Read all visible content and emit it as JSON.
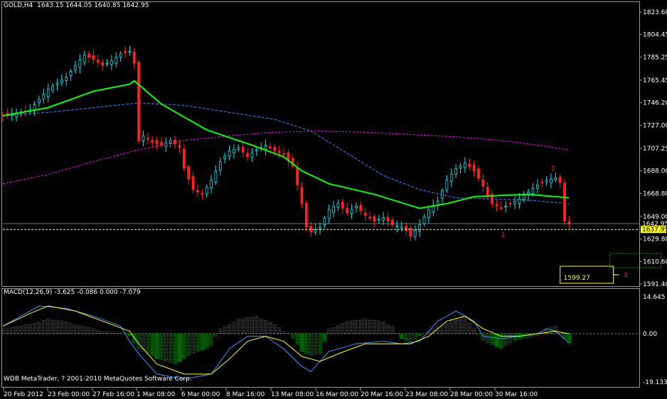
{
  "header": {
    "symbol": "GOLD,H4",
    "ohlc": "1643.15 1644.05 1640.85 1642.95"
  },
  "macd_header": {
    "label": "MACD(12,26,9)",
    "values": "-3.625 -0.086 0.000 -7.079"
  },
  "footer": "WDB MetaTrader, ? 2001-2010 MetaQuotes Software Corp.",
  "price_axis_labels": [
    "1823.60",
    "1804.45",
    "1785.25",
    "1765.45",
    "1746.20",
    "1727.00",
    "1707.25",
    "1688.00",
    "1668.80",
    "1649.00",
    "1629.80",
    "1610.60",
    "1591.40"
  ],
  "price_tags": {
    "current": "1642.95",
    "level": "1637.95"
  },
  "macd_axis_labels": [
    "14.645",
    "0.00",
    "-19.133"
  ],
  "time_labels": [
    "20 Feb 2012",
    "23 Feb 00:00",
    "27 Feb 16:00",
    "1 Mar 08:00",
    "6 Mar 00:00",
    "8 Mar 16:00",
    "13 Mar 08:00",
    "16 Mar 00:00",
    "20 Mar 16:00",
    "23 Mar 08:00",
    "28 Mar 00:00",
    "30 Mar 16:00"
  ],
  "annotations": {
    "target_box_label": "1599.27",
    "wave_1": "1",
    "wave_2": "2",
    "wave_3": "3"
  },
  "colors": {
    "background": "#000000",
    "bull_candle": "#00e5ee",
    "bear_candle": "#ff2020",
    "ma_fast": "#00ff00",
    "ma_mid": "#1e90ff",
    "ma_slow": "#ff00ff",
    "macd_pos_hist": "#ff3030",
    "macd_neg_hist": "#00b000",
    "macd_line": "#3399ff",
    "signal_line": "#ffff00",
    "level_line": "#ffff80",
    "tag_yellow": "#ffff00",
    "annotation_red": "#ff2020",
    "box_green": "#00c000"
  },
  "chart_data": [
    {
      "type": "candlestick",
      "title": "GOLD,H4",
      "ylim": [
        1591.4,
        1823.6
      ],
      "x": [
        "20 Feb 2012",
        "23 Feb 00:00",
        "27 Feb 16:00",
        "1 Mar 08:00",
        "6 Mar 00:00",
        "8 Mar 16:00",
        "13 Mar 08:00",
        "16 Mar 00:00",
        "20 Mar 16:00",
        "23 Mar 08:00",
        "28 Mar 00:00",
        "30 Mar 16:00"
      ],
      "close_path": [
        [
          0,
          1735
        ],
        [
          6,
          1740
        ],
        [
          10,
          1758
        ],
        [
          14,
          1768
        ],
        [
          16,
          1778
        ],
        [
          18,
          1787
        ],
        [
          20,
          1783
        ],
        [
          22,
          1778
        ],
        [
          24,
          1782
        ],
        [
          26,
          1788
        ],
        [
          28,
          1790
        ],
        [
          29,
          1780
        ],
        [
          29.2,
          1710
        ],
        [
          31,
          1718
        ],
        [
          33,
          1712
        ],
        [
          35,
          1710
        ],
        [
          37,
          1714
        ],
        [
          39,
          1708
        ],
        [
          40,
          1690
        ],
        [
          42,
          1672
        ],
        [
          44,
          1668
        ],
        [
          46,
          1680
        ],
        [
          48,
          1696
        ],
        [
          50,
          1705
        ],
        [
          52,
          1708
        ],
        [
          54,
          1700
        ],
        [
          56,
          1706
        ],
        [
          58,
          1710
        ],
        [
          60,
          1705
        ],
        [
          62,
          1702
        ],
        [
          64,
          1692
        ],
        [
          66,
          1660
        ],
        [
          67,
          1640
        ],
        [
          68,
          1636
        ],
        [
          70,
          1640
        ],
        [
          72,
          1655
        ],
        [
          74,
          1660
        ],
        [
          76,
          1652
        ],
        [
          78,
          1658
        ],
        [
          80,
          1650
        ],
        [
          82,
          1645
        ],
        [
          84,
          1648
        ],
        [
          86,
          1642
        ],
        [
          88,
          1640
        ],
        [
          89,
          1637
        ],
        [
          90,
          1632
        ],
        [
          92,
          1642
        ],
        [
          94,
          1655
        ],
        [
          96,
          1662
        ],
        [
          98,
          1680
        ],
        [
          100,
          1690
        ],
        [
          102,
          1695
        ],
        [
          104,
          1688
        ],
        [
          106,
          1675
        ],
        [
          108,
          1660
        ],
        [
          110,
          1656
        ],
        [
          112,
          1660
        ],
        [
          114,
          1664
        ],
        [
          116,
          1670
        ],
        [
          118,
          1676
        ],
        [
          120,
          1680
        ],
        [
          122,
          1682
        ],
        [
          123,
          1678
        ],
        [
          124,
          1645
        ],
        [
          125,
          1642.95
        ]
      ],
      "series": [
        {
          "name": "ma_fast",
          "values": [
            [
              0,
              1735
            ],
            [
              10,
              1742
            ],
            [
              20,
              1756
            ],
            [
              28,
              1762
            ],
            [
              29,
              1765
            ],
            [
              35,
              1745
            ],
            [
              45,
              1723
            ],
            [
              55,
              1710
            ],
            [
              62,
              1700
            ],
            [
              66,
              1688
            ],
            [
              72,
              1677
            ],
            [
              82,
              1668
            ],
            [
              92,
              1656
            ],
            [
              98,
              1660
            ],
            [
              104,
              1666
            ],
            [
              110,
              1667
            ],
            [
              116,
              1668
            ],
            [
              122,
              1666
            ],
            [
              125,
              1665
            ]
          ]
        },
        {
          "name": "ma_mid",
          "values": [
            [
              0,
              1735
            ],
            [
              10,
              1738
            ],
            [
              20,
              1742
            ],
            [
              30,
              1746
            ],
            [
              40,
              1744
            ],
            [
              50,
              1738
            ],
            [
              60,
              1732
            ],
            [
              68,
              1722
            ],
            [
              76,
              1703
            ],
            [
              84,
              1684
            ],
            [
              92,
              1672
            ],
            [
              100,
              1665
            ],
            [
              108,
              1664
            ],
            [
              116,
              1663
            ],
            [
              122,
              1661
            ],
            [
              125,
              1660
            ]
          ]
        },
        {
          "name": "ma_slow",
          "values": [
            [
              0,
              1677
            ],
            [
              10,
              1685
            ],
            [
              20,
              1696
            ],
            [
              30,
              1706
            ],
            [
              40,
              1714
            ],
            [
              50,
              1718
            ],
            [
              60,
              1721
            ],
            [
              70,
              1722
            ],
            [
              80,
              1721
            ],
            [
              90,
              1719
            ],
            [
              100,
              1717
            ],
            [
              110,
              1714
            ],
            [
              118,
              1710
            ],
            [
              125,
              1706
            ]
          ]
        }
      ],
      "annotations": [
        {
          "text": "1",
          "x": 110,
          "y": 1637
        },
        {
          "text": "2",
          "x": 121,
          "y": 1687
        },
        {
          "text": "3",
          "x": 137,
          "y": 1599.27
        },
        {
          "text": "1599.27",
          "x": 123,
          "y": 1599.27
        }
      ]
    },
    {
      "type": "bar",
      "title": "MACD(12,26,9)",
      "ylim": [
        -19.133,
        14.645
      ],
      "x": [
        "20 Feb 2012",
        "23 Feb 00:00",
        "27 Feb 16:00",
        "1 Mar 08:00",
        "6 Mar 00:00",
        "8 Mar 16:00",
        "13 Mar 08:00",
        "16 Mar 00:00",
        "20 Mar 16:00",
        "23 Mar 08:00",
        "28 Mar 00:00",
        "30 Mar 16:00"
      ],
      "series": [
        {
          "name": "histogram",
          "values": [
            [
              0,
              2
            ],
            [
              6,
              4
            ],
            [
              10,
              6
            ],
            [
              14,
              5
            ],
            [
              18,
              3
            ],
            [
              22,
              1
            ],
            [
              26,
              0.5
            ],
            [
              28,
              -1
            ],
            [
              30,
              -6
            ],
            [
              34,
              -10
            ],
            [
              38,
              -12
            ],
            [
              42,
              -8
            ],
            [
              46,
              -5
            ],
            [
              48,
              2
            ],
            [
              52,
              6
            ],
            [
              56,
              7
            ],
            [
              60,
              4
            ],
            [
              62,
              1
            ],
            [
              64,
              -2
            ],
            [
              66,
              -7
            ],
            [
              68,
              -9
            ],
            [
              70,
              -8
            ],
            [
              72,
              2
            ],
            [
              76,
              5
            ],
            [
              80,
              6
            ],
            [
              84,
              5
            ],
            [
              86,
              3
            ],
            [
              88,
              -2
            ],
            [
              90,
              -4
            ],
            [
              92,
              -1
            ],
            [
              96,
              3
            ],
            [
              100,
              6
            ],
            [
              102,
              7
            ],
            [
              106,
              -3
            ],
            [
              110,
              -6
            ],
            [
              114,
              -2
            ],
            [
              118,
              -1
            ],
            [
              120,
              2
            ],
            [
              122,
              3
            ],
            [
              124,
              -2
            ],
            [
              125,
              -3.625
            ]
          ]
        },
        {
          "name": "macd_line",
          "values": [
            [
              0,
              3
            ],
            [
              4,
              7
            ],
            [
              8,
              11
            ],
            [
              14,
              10
            ],
            [
              20,
              7
            ],
            [
              26,
              3
            ],
            [
              28,
              -3
            ],
            [
              30,
              -8
            ],
            [
              34,
              -16
            ],
            [
              40,
              -18
            ],
            [
              46,
              -16
            ],
            [
              50,
              -6
            ],
            [
              54,
              -1
            ],
            [
              58,
              -1
            ],
            [
              62,
              -6
            ],
            [
              66,
              -13
            ],
            [
              68,
              -15
            ],
            [
              72,
              -7
            ],
            [
              78,
              -4
            ],
            [
              84,
              -3
            ],
            [
              88,
              -4
            ],
            [
              92,
              -3
            ],
            [
              96,
              5
            ],
            [
              100,
              9
            ],
            [
              104,
              5
            ],
            [
              106,
              -1
            ],
            [
              110,
              -2
            ],
            [
              114,
              -1
            ],
            [
              118,
              0
            ],
            [
              120,
              2
            ],
            [
              122,
              1
            ],
            [
              125,
              -3.625
            ]
          ]
        },
        {
          "name": "signal_line",
          "values": [
            [
              0,
              3
            ],
            [
              6,
              8
            ],
            [
              10,
              11
            ],
            [
              16,
              9
            ],
            [
              22,
              5
            ],
            [
              28,
              1
            ],
            [
              30,
              -4
            ],
            [
              34,
              -12
            ],
            [
              40,
              -16
            ],
            [
              46,
              -16
            ],
            [
              50,
              -10
            ],
            [
              54,
              -3
            ],
            [
              58,
              -1
            ],
            [
              62,
              -3
            ],
            [
              66,
              -9
            ],
            [
              70,
              -11
            ],
            [
              74,
              -8
            ],
            [
              80,
              -4
            ],
            [
              86,
              -4
            ],
            [
              90,
              -4
            ],
            [
              94,
              -1
            ],
            [
              98,
              5
            ],
            [
              102,
              7
            ],
            [
              106,
              2
            ],
            [
              110,
              -1
            ],
            [
              114,
              -1
            ],
            [
              118,
              0
            ],
            [
              122,
              1
            ],
            [
              125,
              -0.086
            ]
          ]
        }
      ]
    }
  ]
}
